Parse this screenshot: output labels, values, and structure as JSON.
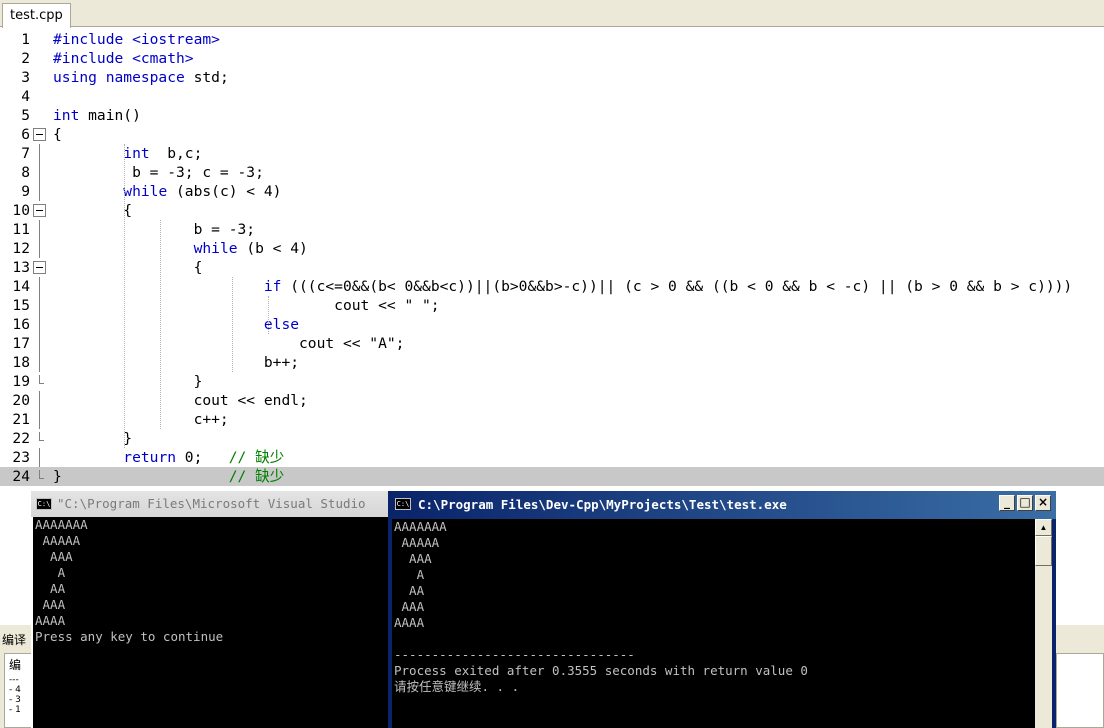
{
  "editor": {
    "tab_label": "test.cpp",
    "lines": [
      {
        "n": "1",
        "html": "<span class='pp'>#include &lt;iostream&gt;</span>"
      },
      {
        "n": "2",
        "html": "<span class='pp'>#include &lt;cmath&gt;</span>"
      },
      {
        "n": "3",
        "html": "<span class='kw'>using namespace</span> std;"
      },
      {
        "n": "4",
        "html": ""
      },
      {
        "n": "5",
        "html": "<span class='kw'>int</span> main()"
      },
      {
        "n": "6",
        "html": "{"
      },
      {
        "n": "7",
        "html": "        <span class='kw'>int</span>  b,c;"
      },
      {
        "n": "8",
        "html": "         b = -3; c = -3;"
      },
      {
        "n": "9",
        "html": "        <span class='kw'>while</span> (abs(c) &lt; 4)"
      },
      {
        "n": "10",
        "html": "        {"
      },
      {
        "n": "11",
        "html": "                b = -3;"
      },
      {
        "n": "12",
        "html": "                <span class='kw'>while</span> (b &lt; 4)"
      },
      {
        "n": "13",
        "html": "                {"
      },
      {
        "n": "14",
        "html": "                        <span class='kw'>if</span> (((c&lt;=0&amp;&amp;(b&lt; 0&amp;&amp;b&lt;c))||(b&gt;0&amp;&amp;b&gt;-c))|| (c &gt; 0 &amp;&amp; ((b &lt; 0 &amp;&amp; b &lt; -c) || (b &gt; 0 &amp;&amp; b &gt; c))))"
      },
      {
        "n": "15",
        "html": "                                cout &lt;&lt; \" \";"
      },
      {
        "n": "16",
        "html": "                        <span class='kw'>else</span>"
      },
      {
        "n": "17",
        "html": "                            cout &lt;&lt; \"A\";"
      },
      {
        "n": "18",
        "html": "                        b++;"
      },
      {
        "n": "19",
        "html": "                }"
      },
      {
        "n": "20",
        "html": "                cout &lt;&lt; endl;"
      },
      {
        "n": "21",
        "html": "                c++;"
      },
      {
        "n": "22",
        "html": "        }"
      },
      {
        "n": "23",
        "html": "        <span class='kw'>return</span> 0;   <span class='cm'>// 缺少</span>"
      },
      {
        "n": "24",
        "html": "}                   <span class='cm'>// 缺少</span>"
      }
    ]
  },
  "bottom_panel": {
    "tab_label": "编译",
    "list_header": "编",
    "list_rows": [
      "---",
      "- 4",
      "- 3",
      "- 1"
    ]
  },
  "console_vs": {
    "title": "\"C:\\Program Files\\Microsoft Visual Studio",
    "output": [
      "AAAAAAA",
      " AAAAA",
      "  AAA",
      "   A",
      "  AA",
      " AAA",
      "AAAA",
      "Press any key to continue"
    ]
  },
  "console_dev": {
    "title": "C:\\Program Files\\Dev-Cpp\\MyProjects\\Test\\test.exe",
    "output": [
      "AAAAAAA",
      " AAAAA",
      "  AAA",
      "   A",
      "  AA",
      " AAA",
      "AAAA",
      "",
      "--------------------------------",
      "Process exited after 0.3555 seconds with return value 0",
      "请按任意键继续. . ."
    ],
    "minimize": "_",
    "maximize": "□",
    "close": "×"
  },
  "colors": {
    "keyword": "#0000c8",
    "comment": "#008000",
    "titlebar_active": "#0a246a"
  }
}
